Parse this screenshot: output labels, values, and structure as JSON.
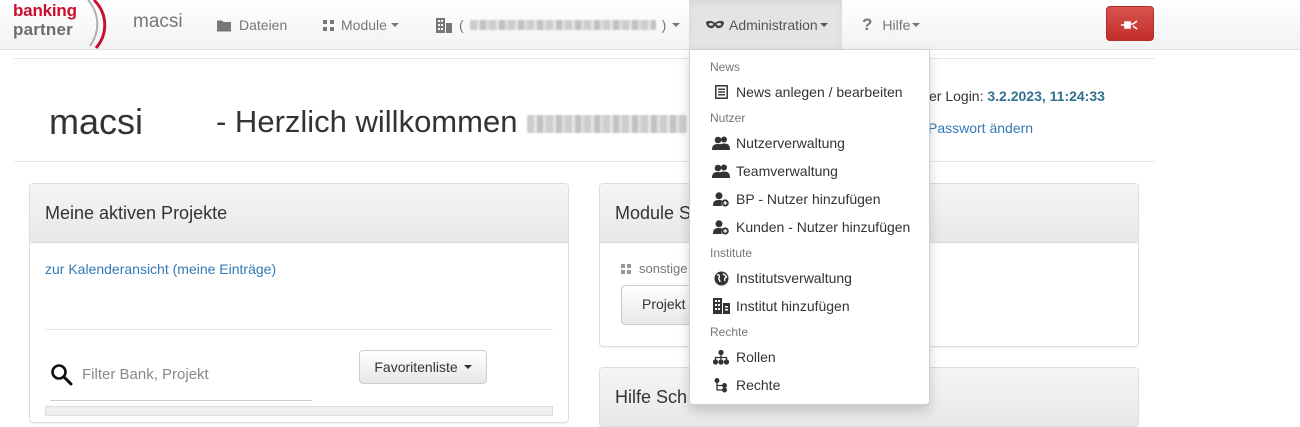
{
  "logo": {
    "line1": "banking",
    "line2": "partner"
  },
  "brand": "macsi",
  "nav": {
    "dateien": "Dateien",
    "module": "Module",
    "bank_open": "(",
    "bank_close": ")",
    "administration": "Administration",
    "hilfe": "Hilfe"
  },
  "header": {
    "title": "macsi",
    "welcome": "- Herzlich willkommen",
    "last_login_label": "er Login:",
    "last_login_value": "3.2.2023, 11:24:33",
    "password_link": "Passwort ändern"
  },
  "projects_panel": {
    "title": "Meine aktiven Projekte",
    "calendar_link": "zur Kalenderansicht (meine Einträge)",
    "filter_placeholder": "Filter Bank, Projekt",
    "favorites_button": "Favoritenliste"
  },
  "modules_panel": {
    "title": "Module S",
    "item": "sonstige",
    "button": "Projekt"
  },
  "help_panel": {
    "title": "Hilfe Sch"
  },
  "admin_menu": {
    "news_header": "News",
    "news_edit": "News anlegen / bearbeiten",
    "nutzer_header": "Nutzer",
    "nutzerverwaltung": "Nutzerverwaltung",
    "teamverwaltung": "Teamverwaltung",
    "bp_add": "BP - Nutzer hinzufügen",
    "kunden_add": "Kunden - Nutzer hinzufügen",
    "institute_header": "Institute",
    "institutsverwaltung": "Institutsverwaltung",
    "institut_add": "Institut hinzufügen",
    "rechte_header": "Rechte",
    "rollen": "Rollen",
    "rechte": "Rechte"
  },
  "colors": {
    "brand_red": "#c8102e",
    "link": "#337ab7",
    "danger": "#d9534f",
    "login_value": "#31708f"
  }
}
